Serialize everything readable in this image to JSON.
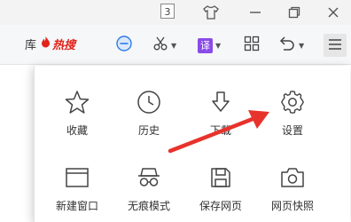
{
  "titlebar": {
    "tab_count": "3",
    "buttons": [
      "skin-icon",
      "minimize-icon",
      "restore-icon",
      "close-icon"
    ]
  },
  "toolbar": {
    "prefix_text": "库",
    "hot_search_label": "热搜",
    "translate_label": "译"
  },
  "menu": {
    "row1": [
      {
        "icon": "star-icon",
        "label": "收藏"
      },
      {
        "icon": "clock-icon",
        "label": "历史"
      },
      {
        "icon": "download-icon",
        "label": "下载"
      },
      {
        "icon": "gear-icon",
        "label": "设置"
      }
    ],
    "row2": [
      {
        "icon": "new-window-icon",
        "label": "新建窗口"
      },
      {
        "icon": "incognito-icon",
        "label": "无痕模式"
      },
      {
        "icon": "save-icon",
        "label": "保存网页"
      },
      {
        "icon": "camera-icon",
        "label": "网页快照"
      }
    ]
  },
  "colors": {
    "accent_blue": "#2b7de9",
    "translate_purple": "#8a4be8",
    "hot_red": "#e2231a",
    "arrow_red": "#e8322c"
  }
}
